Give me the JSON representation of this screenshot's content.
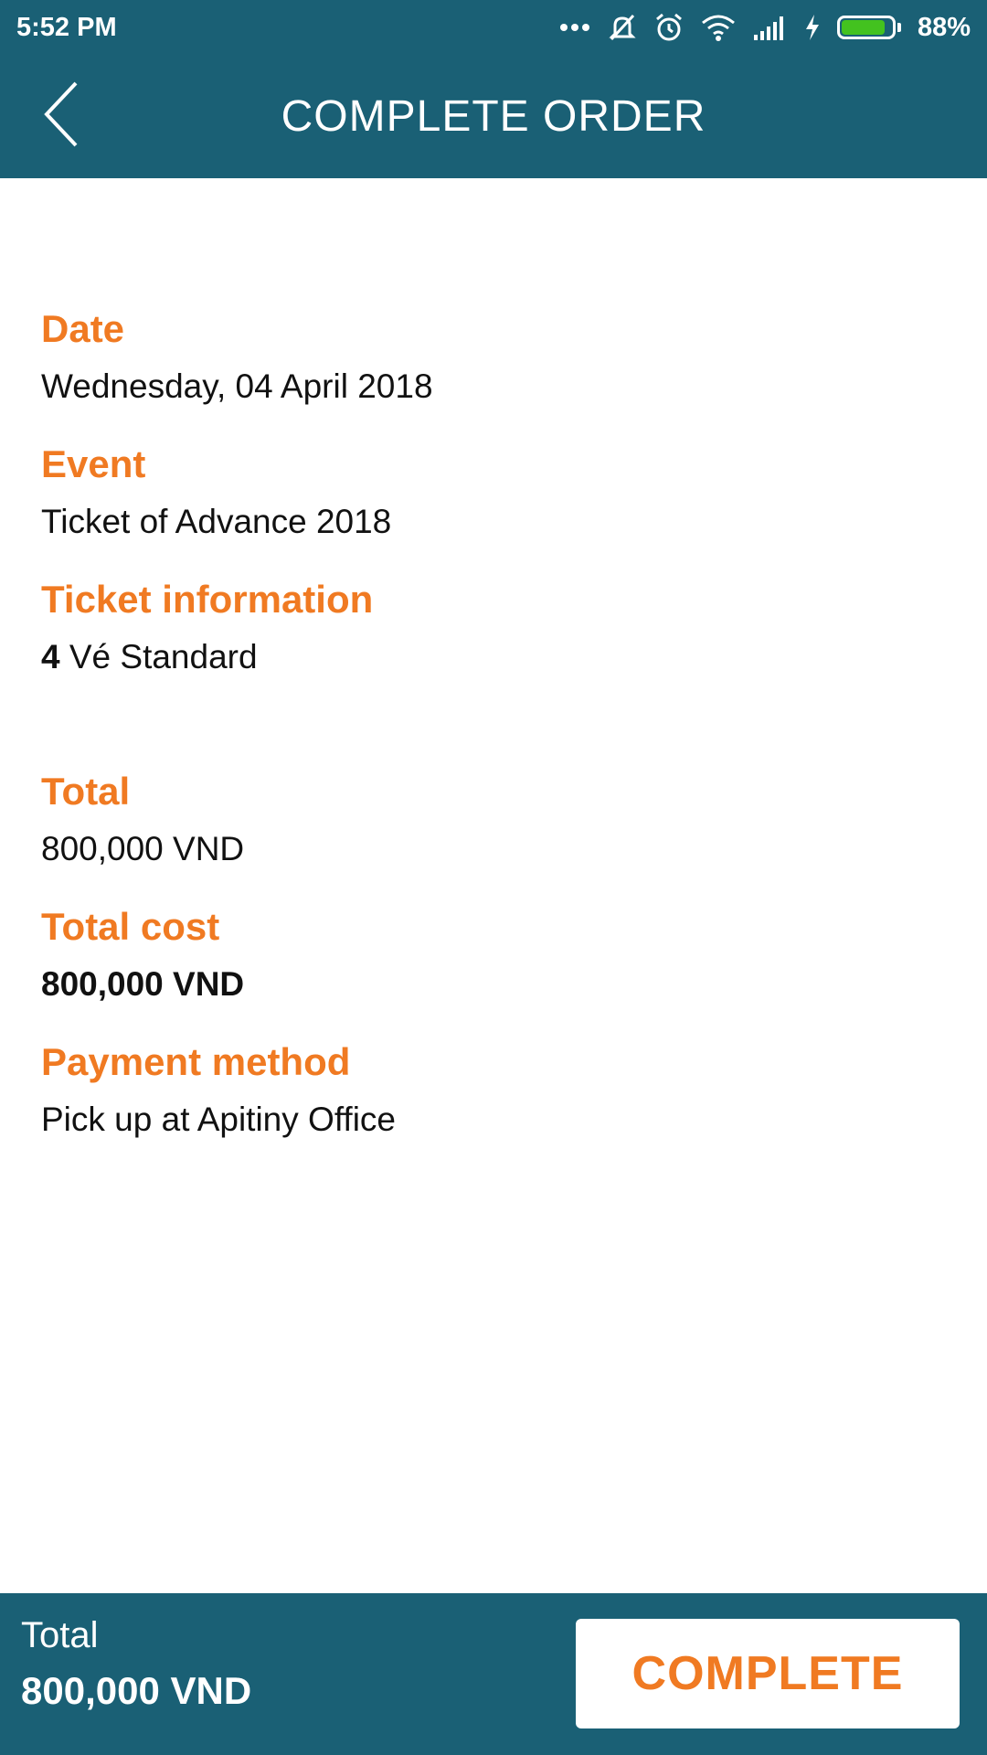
{
  "status_bar": {
    "time": "5:52 PM",
    "battery_percent": "88%",
    "battery_level": 0.88,
    "icons": [
      "more-dots-icon",
      "silent-icon",
      "alarm-icon",
      "wifi-icon",
      "signal-icon",
      "charging-icon",
      "battery-icon"
    ]
  },
  "header": {
    "title": "COMPLETE ORDER",
    "back_icon": "back-arrow-icon"
  },
  "order": {
    "date_label": "Date",
    "date_value": "Wednesday, 04 April 2018",
    "event_label": "Event",
    "event_value": "Ticket of Advance 2018",
    "ticket_label": "Ticket information",
    "ticket_quantity": "4",
    "ticket_type": " Vé Standard",
    "total_label": "Total",
    "total_value": "800,000 VND",
    "total_cost_label": "Total cost",
    "total_cost_value": "800,000 VND",
    "payment_label": "Payment method",
    "payment_value": "Pick up at Apitiny Office"
  },
  "footer": {
    "total_label": "Total",
    "total_value": "800,000 VND",
    "complete_button": "COMPLETE"
  },
  "colors": {
    "primary": "#1a6075",
    "accent": "#f07a22",
    "battery": "#43c21f"
  }
}
